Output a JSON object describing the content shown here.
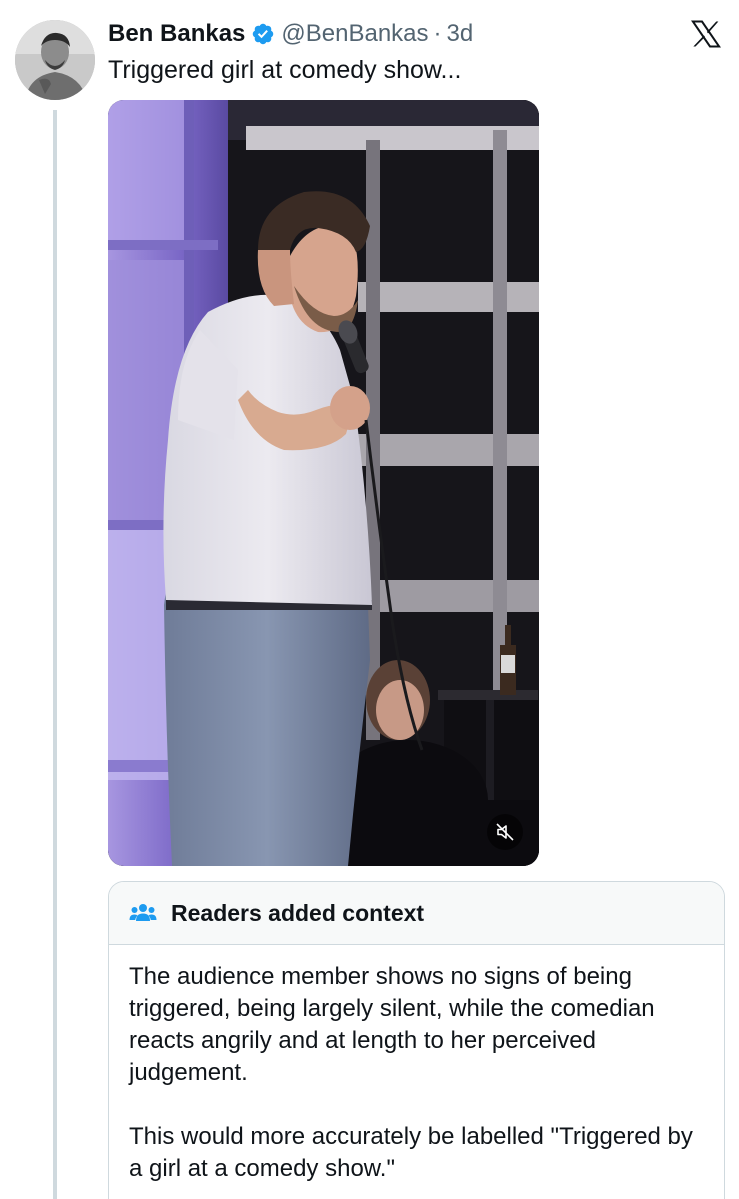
{
  "tweet": {
    "display_name": "Ben Bankas",
    "handle": "@BenBankas",
    "separator": "·",
    "time": "3d",
    "text": "Triggered girl at comedy show..."
  },
  "icons": {
    "verified": "verified-badge-icon",
    "platform": "x-logo-icon",
    "mute": "speaker-muted-icon",
    "community": "people-icon"
  },
  "colors": {
    "verified_blue": "#1d9bf0",
    "note_icon_blue": "#1d9bf0",
    "secondary_text": "#536471",
    "border": "#cfd9de"
  },
  "community_note": {
    "title": "Readers added context",
    "paragraphs": [
      "The audience member shows no signs of being triggered, being largely silent, while the comedian reacts angrily and at length to her perceived judgement.",
      "This would more accurately be labelled \"Triggered by a girl at a comedy show.\""
    ]
  }
}
